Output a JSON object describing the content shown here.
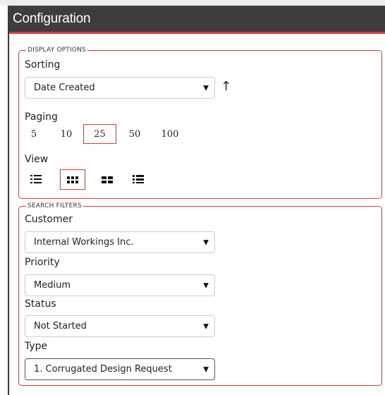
{
  "header": {
    "title": "Configuration"
  },
  "display_options": {
    "legend": "DISPLAY OPTIONS",
    "sorting": {
      "label": "Sorting",
      "value": "Date Created",
      "direction_icon": "arrow-up-icon"
    },
    "paging": {
      "label": "Paging",
      "options": [
        "5",
        "10",
        "25",
        "50",
        "100"
      ],
      "selected": "25"
    },
    "view": {
      "label": "View",
      "options": [
        "list-detail-icon",
        "grid-small-icon",
        "grid-large-icon",
        "list-icon"
      ],
      "selected": "grid-small-icon"
    }
  },
  "search_filters": {
    "legend": "SEARCH FILTERS",
    "customer": {
      "label": "Customer",
      "value": "Internal Workings Inc."
    },
    "priority": {
      "label": "Priority",
      "value": "Medium"
    },
    "status": {
      "label": "Status",
      "value": "Not Started"
    },
    "type": {
      "label": "Type",
      "value": "1. Corrugated Design Request"
    }
  },
  "colors": {
    "accent": "#e0383b",
    "header_bg": "#3d3d3d"
  }
}
